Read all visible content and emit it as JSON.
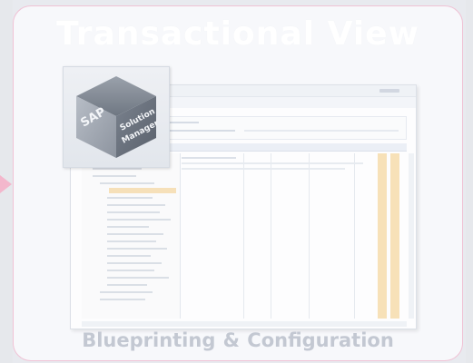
{
  "slide": {
    "title": "Transactional View",
    "caption": "Blueprinting &  Configuration"
  },
  "logo": {
    "icon": "cube-icon",
    "brand": "SAP",
    "line1": "Solution",
    "line2": "Manager"
  },
  "colors": {
    "background": "#e8eaef",
    "card_border": "#f0c2d5",
    "arrow": "#f3b7cc",
    "caption": "#c3c8d2",
    "highlight": "#f6dba9"
  }
}
